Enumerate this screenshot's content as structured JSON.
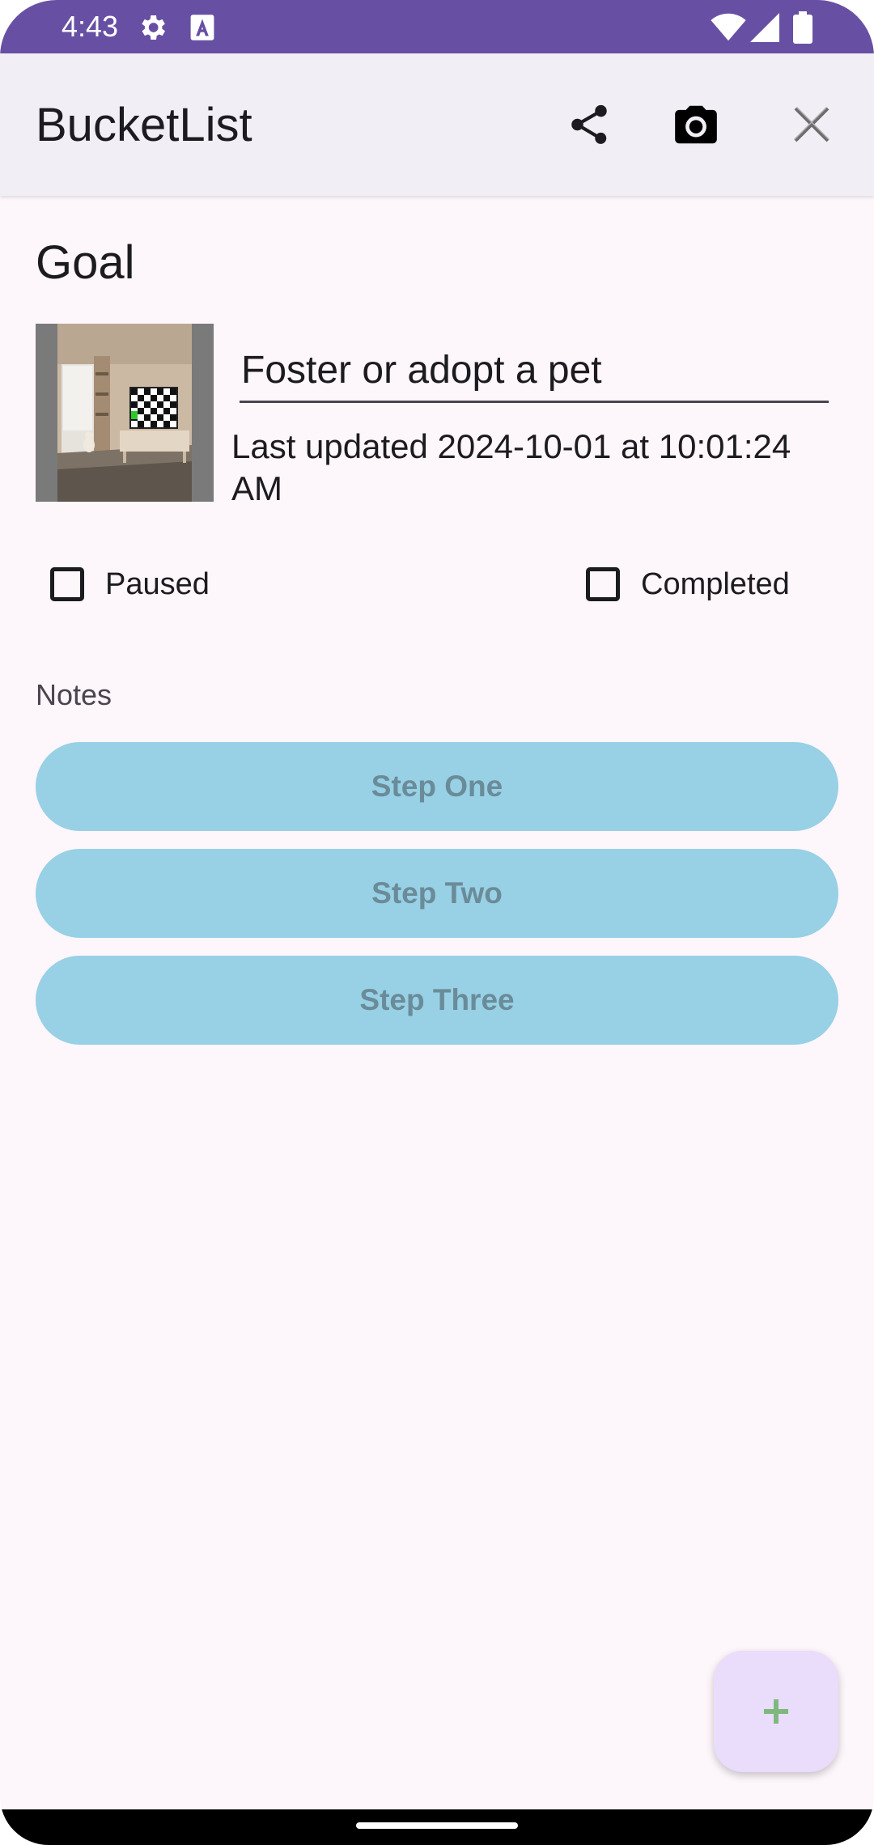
{
  "status_bar": {
    "time": "4:43",
    "icons": [
      "gear-icon",
      "text-a-icon",
      "wifi-icon",
      "signal-icon",
      "battery-icon"
    ]
  },
  "app_bar": {
    "title": "BucketList",
    "actions": [
      "share-icon",
      "camera-icon",
      "close-icon"
    ]
  },
  "goal": {
    "section_title": "Goal",
    "photo": "goal-photo",
    "title_value": "Foster or adopt a pet",
    "last_updated": "Last updated 2024-10-01 at 10:01:24 AM",
    "paused_label": "Paused",
    "paused_checked": false,
    "completed_label": "Completed",
    "completed_checked": false
  },
  "notes": {
    "label": "Notes",
    "steps": [
      {
        "label": "Step One"
      },
      {
        "label": "Step Two"
      },
      {
        "label": "Step Three"
      }
    ]
  },
  "fab": {
    "icon": "plus-icon"
  },
  "colors": {
    "status_bar": "#6750a4",
    "app_bar": "#f2eef5",
    "background": "#fdf6fb",
    "step_button": "#98d0e5",
    "step_text": "#6a8b98",
    "fab": "#eadcfb",
    "fab_icon": "#7fb87f"
  }
}
